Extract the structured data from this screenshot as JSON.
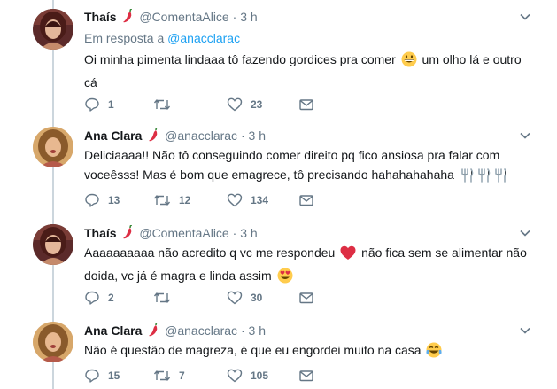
{
  "tweets": [
    {
      "name": "Thaís",
      "handle": "@ComentaAlice",
      "separator": "·",
      "time": "3 h",
      "reply_prefix": "Em resposta a",
      "reply_handle": "@anacclarac",
      "text_1": "Oi minha pimenta lindaaa tô fazendo gordices pra comer",
      "text_2": "um olho lá e outro cá",
      "replies": "1",
      "retweets": "",
      "likes": "23"
    },
    {
      "name": "Ana Clara",
      "handle": "@anacclarac",
      "separator": "·",
      "time": "3 h",
      "text_1": "Deliciaaaa!! Não tô conseguindo comer direito pq fico ansiosa pra falar com voceêsss! Mas é bom que emagrece, tô precisando hahahahahaha",
      "replies": "13",
      "retweets": "12",
      "likes": "134"
    },
    {
      "name": "Thaís",
      "handle": "@ComentaAlice",
      "separator": "·",
      "time": "3 h",
      "text_1": "Aaaaaaaaaa não acredito q vc me respondeu",
      "text_2": "não fica sem se alimentar não doida, vc já é magra e linda assim",
      "replies": "2",
      "retweets": "",
      "likes": "30"
    },
    {
      "name": "Ana Clara",
      "handle": "@anacclarac",
      "separator": "·",
      "time": "3 h",
      "text_1": "Não é questão de magreza, é que eu engordei muito na casa",
      "replies": "15",
      "retweets": "7",
      "likes": "105"
    }
  ],
  "colors": {
    "name": "#14171a",
    "meta": "#657786",
    "link": "#1da1f2",
    "thread_line": "#ccd6dd",
    "heart_emoji": "#dd2e44",
    "pepper": "#dd2e44"
  },
  "icons": {
    "caret": "chevron-down-icon",
    "reply": "reply-icon",
    "retweet": "retweet-icon",
    "like": "heart-icon",
    "message": "envelope-icon"
  }
}
